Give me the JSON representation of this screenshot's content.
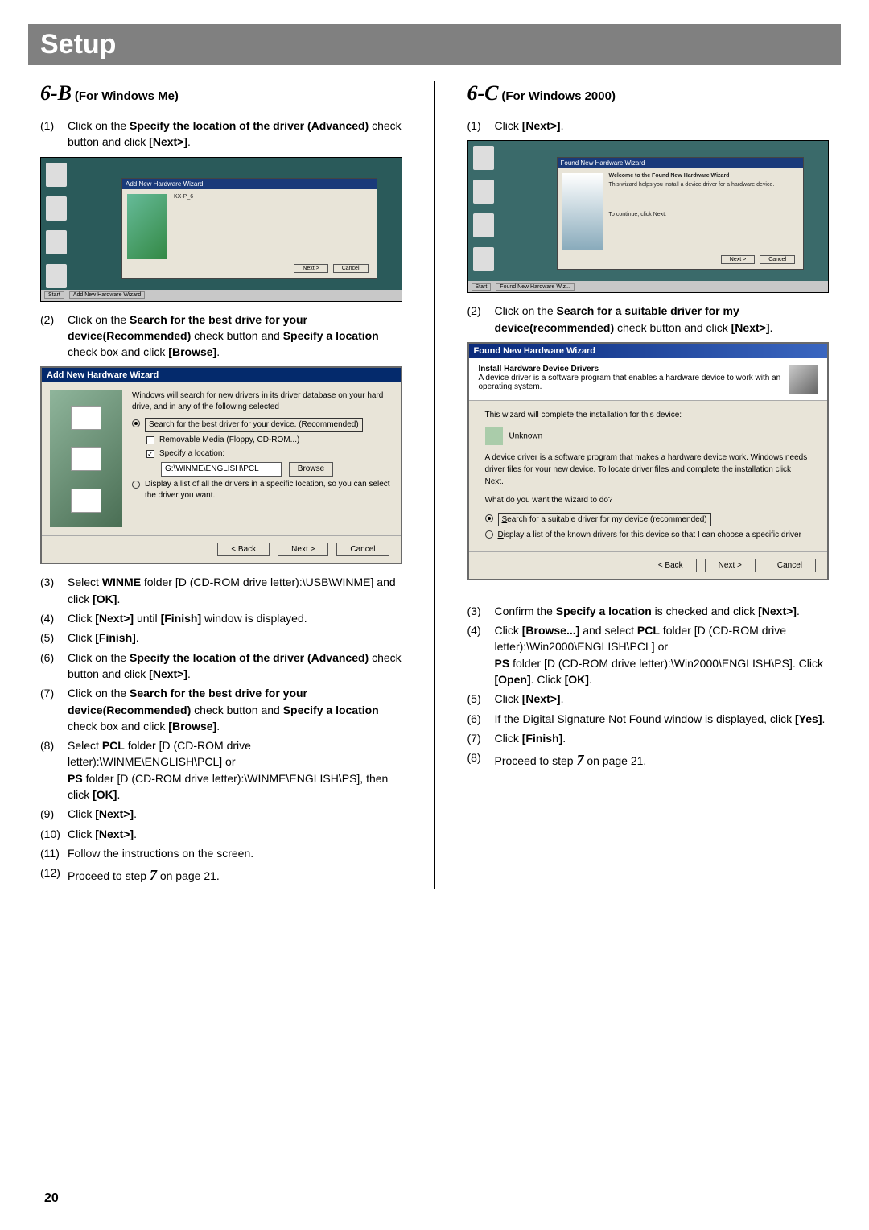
{
  "title": "Setup",
  "page_number": "20",
  "left": {
    "section_num": "6-B",
    "section_title": "(For Windows Me)",
    "step1_num": "(1)",
    "step1_a": "Click on the ",
    "step1_b": "Specify the location of the driver (Advanced)",
    "step1_c": " check button and click ",
    "step1_d": "[Next>]",
    "step1_e": ".",
    "ss1": {
      "dialog_title": "Add New Hardware Wizard",
      "btn_next": "Next >",
      "btn_cancel": "Cancel",
      "taskbar_start": "Start",
      "taskbar_item": "Add New Hardware Wizard"
    },
    "step2_num": "(2)",
    "step2_a": "Click on the ",
    "step2_b": "Search for the best drive for your device(Recommended)",
    "step2_c": " check button and ",
    "step2_d": "Specify a location",
    "step2_e": " check box and click ",
    "step2_f": "[Browse]",
    "step2_g": ".",
    "ss2": {
      "title": "Add New Hardware Wizard",
      "intro": "Windows will search for new drivers in its driver database on your hard drive, and in any of the following selected",
      "opt1": "Search for the best driver for your device. (Recommended)",
      "opt_rem": "Removable Media (Floppy, CD-ROM...)",
      "opt_spec": "Specify a location:",
      "path": "G:\\WINME\\ENGLISH\\PCL",
      "browse": "Browse",
      "opt2": "Display a list of all the drivers in a specific location, so you can select the driver you want.",
      "back": "< Back",
      "next": "Next >",
      "cancel": "Cancel"
    },
    "s3n": "(3)",
    "s3": "Select WINME folder [D (CD-ROM drive letter):\\USB\\WINME] and click [OK].",
    "s4n": "(4)",
    "s4": "Click [Next>] until [Finish] window is displayed.",
    "s5n": "(5)",
    "s5": "Click [Finish].",
    "s6n": "(6)",
    "s6": "Click on the Specify the location of the driver (Advanced) check button and click [Next>].",
    "s7n": "(7)",
    "s7": "Click on the Search for the best drive for your device(Recommended) check button and Specify a location check box and click [Browse].",
    "s8n": "(8)",
    "s8a": "Select ",
    "s8b": "PCL",
    "s8c": " folder [D (CD-ROM drive letter):\\WINME\\ENGLISH\\PCL] or",
    "s8d": "PS",
    "s8e": " folder [D (CD-ROM drive letter):\\WINME\\ENGLISH\\PS], then click ",
    "s8f": "[OK]",
    "s8g": ".",
    "s9n": "(9)",
    "s9": "Click [Next>].",
    "s10n": "(10)",
    "s10": "Click [Next>].",
    "s11n": "(11)",
    "s11": "Follow the instructions on the screen.",
    "s12n": "(12)",
    "s12a": "Proceed to step ",
    "s12b": "7",
    "s12c": " on page 21."
  },
  "right": {
    "section_num": "6-C",
    "section_title": "(For Windows 2000)",
    "step1_num": "(1)",
    "step1_a": "Click ",
    "step1_b": "[Next>]",
    "step1_c": ".",
    "ss1": {
      "dialog_title": "Found New Hardware Wizard",
      "welcome": "Welcome to the Found New Hardware Wizard",
      "desc": "This wizard helps you install a device driver for a hardware device.",
      "cont": "To continue, click Next.",
      "next": "Next >",
      "cancel": "Cancel",
      "taskbar_item": "Found New Hardware Wiz..."
    },
    "step2_num": "(2)",
    "step2_a": "Click on the ",
    "step2_b": "Search for a suitable driver for my device(recommended)",
    "step2_c": " check button and click ",
    "step2_d": "[Next>]",
    "step2_e": ".",
    "ss2": {
      "title": "Found New Hardware Wizard",
      "head1": "Install Hardware Device Drivers",
      "head2": "A device driver is a software program that enables a hardware device to work with an operating system.",
      "line1": "This wizard will complete the installation for this device:",
      "dev": "Unknown",
      "line2": "A device driver is a software program that makes a hardware device work. Windows needs driver files for your new device. To locate driver files and complete the installation click Next.",
      "line3": "What do you want the wizard to do?",
      "opt1_a": "S",
      "opt1_b": "earch for a suitable driver for my device (recommended)",
      "opt2_a": "D",
      "opt2_b": "isplay a list of the known drivers for this device so that I can choose a specific driver",
      "back": "< Back",
      "next": "Next >",
      "cancel": "Cancel"
    },
    "s3n": "(3)",
    "s3a": "Confirm the ",
    "s3b": "Specify a location",
    "s3c": " is checked and click ",
    "s3d": "[Next>]",
    "s3e": ".",
    "s4n": "(4)",
    "s4a": "Click ",
    "s4b": "[Browse...]",
    "s4c": " and select ",
    "s4d": "PCL",
    "s4e": " folder [D (CD-ROM drive letter):\\Win2000\\ENGLISH\\PCL] or",
    "s4f": "PS",
    "s4g": " folder [D (CD-ROM drive letter):\\Win2000\\ENGLISH\\PS]. Click ",
    "s4h": "[Open]",
    "s4i": ". Click ",
    "s4j": "[OK]",
    "s4k": ".",
    "s5n": "(5)",
    "s5a": "Click ",
    "s5b": "[Next>]",
    "s5c": ".",
    "s6n": "(6)",
    "s6a": "If the Digital Signature Not Found window is displayed, click ",
    "s6b": "[Yes]",
    "s6c": ".",
    "s7n": "(7)",
    "s7a": "Click ",
    "s7b": "[Finish]",
    "s7c": ".",
    "s8n": "(8)",
    "s8a": "Proceed to step ",
    "s8b": "7",
    "s8c": " on page 21."
  }
}
